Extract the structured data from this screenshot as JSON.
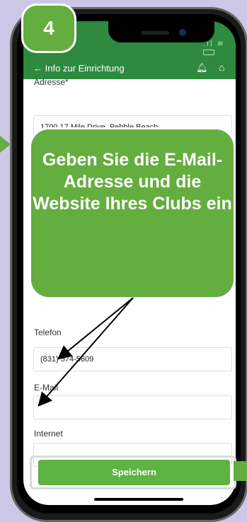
{
  "step": {
    "number": "4"
  },
  "navbar": {
    "back_label": "← Info zur Einrichtung",
    "bell_icon": "bell-icon",
    "home_icon": "home-icon"
  },
  "form": {
    "address_label": "Adresse*",
    "address_value": "1700 17 Mile Drive, Pebble Beach",
    "phone_label": "Telefon",
    "phone_value": "(831) 574-5609",
    "email_label": "E-Mail",
    "email_value": "",
    "internet_label": "Internet",
    "internet_value": ""
  },
  "save_button": {
    "label": "Speichern"
  },
  "callout": {
    "text": "Geben Sie die E-Mail-Adresse und die Website Ihres Clubs ein"
  },
  "colors": {
    "nav_green": "#2d8a3e",
    "callout_green": "#64ad3f",
    "button_green": "#5eb342",
    "background": "#ccc7e6"
  }
}
